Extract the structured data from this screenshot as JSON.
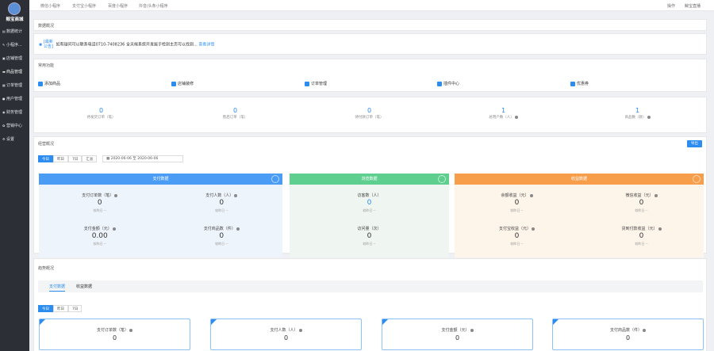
{
  "app": {
    "name": "鲸宝商城"
  },
  "sidebar": {
    "items": [
      {
        "icon": "chart-icon",
        "label": "数据统计"
      },
      {
        "icon": "mini-program-icon",
        "label": "小程序..."
      },
      {
        "icon": "store-icon",
        "label": "店铺管理"
      },
      {
        "icon": "product-icon",
        "label": "商品管理"
      },
      {
        "icon": "order-icon",
        "label": "订单管理"
      },
      {
        "icon": "user-icon",
        "label": "用户管理"
      },
      {
        "icon": "finance-icon",
        "label": "财务管理"
      },
      {
        "icon": "marketing-icon",
        "label": "营销中心"
      },
      {
        "icon": "gear-icon",
        "label": "设置"
      }
    ]
  },
  "topnav": {
    "tabs": [
      "微信小程序",
      "支付宝小程序",
      "百度小程序",
      "抖音/头条小程序"
    ],
    "help": "操作",
    "user": "鲸宝直播"
  },
  "overview": {
    "title": "数据概况",
    "notice_tag": "[最新公告]",
    "notice_text": "如有疑问可以联系电话0710-7408236 全天候系统开发属于检到主页可以找到...",
    "notice_more": "查看详情"
  },
  "functions": {
    "title": "常用功能",
    "items": [
      "添加商品",
      "店铺装修",
      "订单管理",
      "插件中心",
      "优惠券"
    ]
  },
  "stats": [
    {
      "value": "0",
      "label": "待发货订单（笔）",
      "help": false
    },
    {
      "value": "0",
      "label": "售后订单（笔）",
      "help": false
    },
    {
      "value": "0",
      "label": "待付款订单（笔）",
      "help": false
    },
    {
      "value": "1",
      "label": "总用户数（人）",
      "help": true
    },
    {
      "value": "1",
      "label": "商品数（款）",
      "help": true
    }
  ],
  "operations": {
    "title": "经营概况",
    "export": "导出",
    "ranges": [
      "今日",
      "昨日",
      "7日",
      "汇总"
    ],
    "date_start": "2020-06-06",
    "date_sep": "至",
    "date_end": "2020-06-06",
    "cards": [
      {
        "title": "支付数据",
        "color": "#4a9cf5",
        "bg": "#eef4fb",
        "cells": [
          {
            "t": "支付订单数（笔）",
            "v": "0",
            "c": "较昨日 --"
          },
          {
            "t": "支付人数（人）",
            "v": "0",
            "c": "较昨日 --"
          },
          {
            "t": "支付金额（元）",
            "v": "0.00",
            "c": "较昨日 --"
          },
          {
            "t": "支付商品数（件）",
            "v": "0",
            "c": "较昨日 --"
          }
        ]
      },
      {
        "title": "浏览数据",
        "color": "#5fcf8f",
        "bg": "#eff5f1",
        "cells": [
          {
            "t": "访客数（人）",
            "v": "0",
            "c": "较昨日 --"
          },
          {
            "t": "访问量（次）",
            "v": "0",
            "c": "较昨日 --"
          }
        ]
      },
      {
        "title": "收益数据",
        "color": "#f79e4a",
        "bg": "#fdf4ea",
        "cells": [
          {
            "t": "余额收益（元）",
            "v": "0",
            "c": "较昨日 --"
          },
          {
            "t": "微信收益（元）",
            "v": "0",
            "c": "较昨日 --"
          },
          {
            "t": "支付宝收益（元）",
            "v": "0",
            "c": "较昨日 --"
          },
          {
            "t": "货到付款收益（元）",
            "v": "0",
            "c": "较昨日 --"
          }
        ]
      }
    ]
  },
  "trend": {
    "title": "趋势概况",
    "tabs": [
      "支付数据",
      "收益数据"
    ],
    "ranges": [
      "今日",
      "昨日",
      "7日"
    ],
    "cards": [
      {
        "t": "支付订单数（笔）",
        "v": "0"
      },
      {
        "t": "支付人数（人）",
        "v": "0"
      },
      {
        "t": "支付金额（元）",
        "v": "0"
      },
      {
        "t": "支付商品数（件）",
        "v": "0"
      }
    ]
  }
}
